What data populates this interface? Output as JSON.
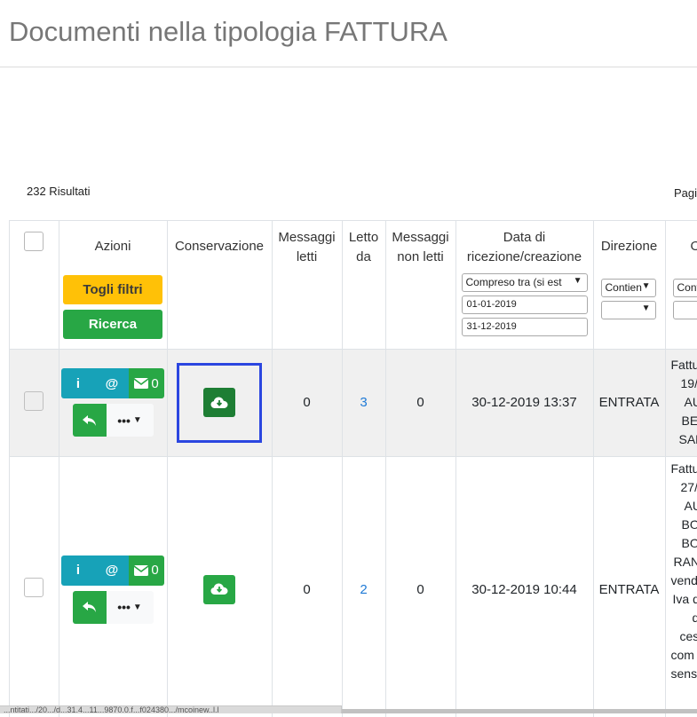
{
  "page": {
    "title": "Documenti nella tipologia FATTURA"
  },
  "results": {
    "count_label": "232 Risultati",
    "pagination_label": "Pagi"
  },
  "table": {
    "headers": {
      "azioni": "Azioni",
      "conservazione": "Conservazione",
      "messaggi_letti": "Messaggi letti",
      "letto_da": "Letto da",
      "messaggi_non_letti": "Messaggi non letti",
      "data": "Data di ricezione/creazione",
      "direzione": "Direzione",
      "cut": "O"
    },
    "filters": {
      "togli_filtri": "Togli filtri",
      "ricerca": "Ricerca",
      "date_mode": "Compreso tra (si est",
      "date_from": "01-01-2019",
      "date_to": "31-12-2019",
      "direzione_mode": "Contien",
      "oggetto_mode": "Conti"
    },
    "rows": [
      {
        "mail_count": "0",
        "messaggi_letti": "0",
        "letto_da": "3",
        "messaggi_non_letti": "0",
        "data": "30-12-2019 13:37",
        "direzione": "ENTRATA",
        "desc_lines": [
          "Fattu",
          "19/",
          "AU",
          "BEI",
          "SAN"
        ]
      },
      {
        "mail_count": "0",
        "messaggi_letti": "0",
        "letto_da": "2",
        "messaggi_non_letti": "0",
        "data": "30-12-2019 10:44",
        "direzione": "ENTRATA",
        "desc_lines": [
          "Fattu",
          "27/",
          "AU",
          "BO",
          "BO",
          "RAN",
          "vend",
          "Iva d",
          "d",
          "ces",
          "com",
          "sensi"
        ]
      }
    ]
  },
  "statusbar": {
    "url": "...ntitati.../20.../d...31.4...11...9870.0.f...f024380.../mcoinew..l.l"
  },
  "icons": {
    "info": "i",
    "at": "@",
    "more": "•••"
  }
}
